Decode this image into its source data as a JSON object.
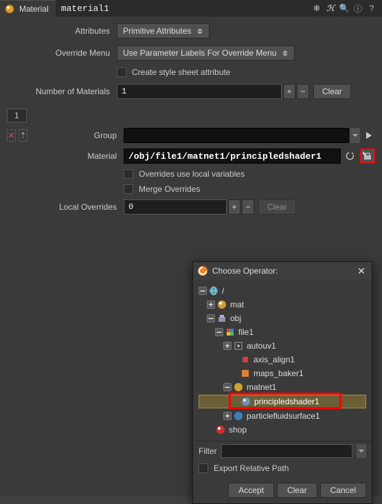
{
  "header": {
    "node_type": "Material",
    "node_name": "material1",
    "btns": {
      "gear": "✻",
      "h": "ℋ",
      "search": "🔍",
      "info": "ⓘ",
      "help": "?"
    }
  },
  "params": {
    "attributes_label": "Attributes",
    "attributes_value": "Primitive Attributes",
    "override_menu_label": "Override Menu",
    "override_menu_value": "Use Parameter Labels For Override Menu",
    "create_stylesheet_label": "Create style sheet attribute",
    "num_materials_label": "Number of Materials",
    "num_materials_value": "1",
    "spin_plus": "+",
    "spin_minus": "−",
    "clear_label": "Clear"
  },
  "material_instance": {
    "tab_label": "1",
    "group_label": "Group",
    "group_value": "",
    "material_label": "Material",
    "material_value": "/obj/file1/matnet1/principledshader1",
    "overrides_local_label": "Overrides use local variables",
    "merge_overrides_label": "Merge Overrides",
    "local_overrides_label": "Local Overrides",
    "local_overrides_value": "0",
    "clear_label": "Clear"
  },
  "popup": {
    "title": "Choose Operator:",
    "tree": {
      "root": "/",
      "mat": "mat",
      "obj": "obj",
      "file1": "file1",
      "autouv1": "autouv1",
      "axis_align1": "axis_align1",
      "maps_baker1": "maps_baker1",
      "matnet1": "matnet1",
      "principledshader1": "principledshader1",
      "particlefluidsurface1": "particlefluidsurface1",
      "shop": "shop"
    },
    "filter_label": "Filter",
    "filter_value": "",
    "export_relative_label": "Export Relative Path",
    "accept": "Accept",
    "clear": "Clear",
    "cancel": "Cancel"
  }
}
